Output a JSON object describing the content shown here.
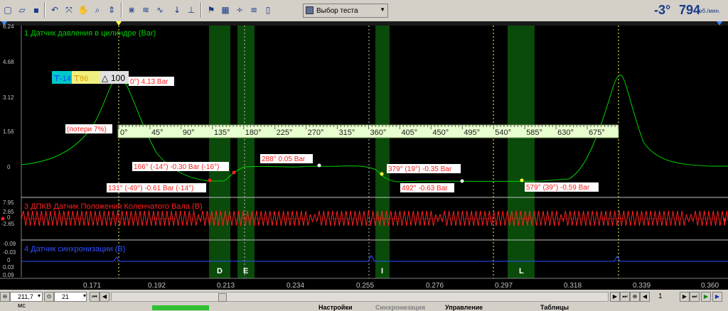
{
  "toolbar": {
    "test_select": "Выбор теста",
    "angle": "-3°",
    "rpm": "794",
    "rpm_unit": "об./мин."
  },
  "channels": {
    "ch1": "1 Датчик давления в цилиндре (Bar)",
    "ch3": "3 ДПКВ Датчик Положения Коленчатого Вала (В)",
    "ch4": "4 Датчик синхронизации (В)"
  },
  "y_ticks_ch1": [
    "6.24",
    "4.68",
    "3.12",
    "1.56",
    "0"
  ],
  "y_ticks_ch3": [
    "7.95",
    "2.65",
    "0",
    "-2.65"
  ],
  "y_ticks_ch4": [
    "-0.09",
    "-0.03",
    "0",
    "0.03",
    "0.09"
  ],
  "x_ticks": [
    "0.171",
    "0.192",
    "0.213",
    "0.234",
    "0.255",
    "0.276",
    "0.297",
    "0.318",
    "0.339",
    "0.360"
  ],
  "angle_scale": [
    "0°",
    "45°",
    "90°",
    "135°",
    "180°",
    "225°",
    "270°",
    "315°",
    "360°",
    "405°",
    "450°",
    "495°",
    "540°",
    "585°",
    "630°",
    "675°"
  ],
  "zones": [
    "D",
    "E",
    "I",
    "L"
  ],
  "cursor_box": {
    "a": "-14",
    "b": "86",
    "c": "100"
  },
  "annotations": {
    "peak": "0°) 4.13 Bar",
    "loss": "(потери 7%)",
    "a166": "166° (-14°) -0.30 Bar (-16°)",
    "a131": "131° (-49°) -0.61 Bar (-14°)",
    "a288": "288° 0.05 Bar",
    "a379": "379° (19°) -0.35 Bar",
    "a492": "492° -0.63 Bar",
    "a579": "579° (39°) -0.59 Bar"
  },
  "statusbar": {
    "time": "211,7 мс",
    "count": "21",
    "page": "1",
    "tabs": [
      "Настройки",
      "Синхронизация",
      "Управление",
      "Таблицы"
    ]
  },
  "colors": {
    "ch1": "#00d000",
    "ch3": "#ff2020",
    "ch4": "#3050ff",
    "zone": "#0a4a0a",
    "label_red": "#ff2020",
    "scale_bg": "#e8ffd0"
  }
}
